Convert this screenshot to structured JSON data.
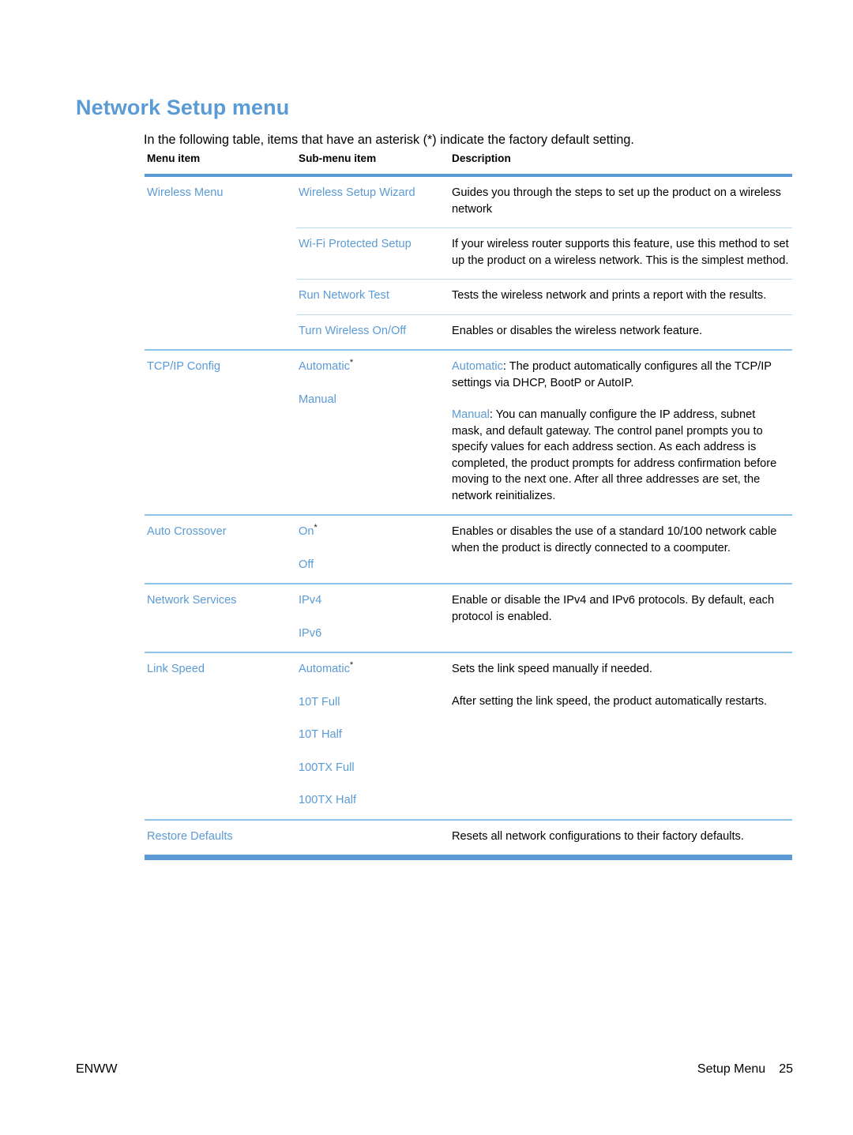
{
  "document": {
    "heading": "Network Setup menu",
    "intro": "In the following table, items that have an asterisk (*) indicate the factory default setting.",
    "accent_color": "#5b9bd5",
    "rule_color": "#8ec3ea",
    "inner_rule_color": "#b9d9ef"
  },
  "table": {
    "headers": {
      "menu_item": "Menu item",
      "sub_menu_item": "Sub-menu item",
      "description": "Description"
    },
    "rows": [
      {
        "menu_item": "Wireless Menu",
        "sub_rows": [
          {
            "sub_menu_item": "Wireless Setup Wizard",
            "default": false,
            "description": "Guides you through the steps to set up the product on a wireless network"
          },
          {
            "sub_menu_item": "Wi-Fi Protected Setup",
            "default": false,
            "description": "If your wireless router supports this feature, use this method to set up the product on a wireless network. This is the simplest method."
          },
          {
            "sub_menu_item": "Run Network Test",
            "default": false,
            "description": "Tests the wireless network and prints a report with the results."
          },
          {
            "sub_menu_item": "Turn Wireless On/Off",
            "default": false,
            "description": "Enables or disables the wireless network feature."
          }
        ]
      },
      {
        "menu_item": "TCP/IP Config",
        "sub_items": [
          {
            "label": "Automatic",
            "default": true
          },
          {
            "label": "Manual",
            "default": false
          }
        ],
        "description_parts": [
          {
            "term": "Automatic",
            "text": ": The product automatically configures all the TCP/IP settings via DHCP, BootP or AutoIP."
          },
          {
            "term": "Manual",
            "text": ": You can manually configure the IP address, subnet mask, and default gateway. The control panel prompts you to specify values for each address section. As each address is completed, the product prompts for address confirmation before moving to the next one. After all three addresses are set, the network reinitializes."
          }
        ]
      },
      {
        "menu_item": "Auto Crossover",
        "sub_items": [
          {
            "label": "On",
            "default": true
          },
          {
            "label": "Off",
            "default": false
          }
        ],
        "description_parts": [
          {
            "term": "",
            "text": "Enables or disables the use of a standard 10/100 network cable when the product is directly connected to a coomputer."
          }
        ]
      },
      {
        "menu_item": "Network Services",
        "sub_items": [
          {
            "label": "IPv4",
            "default": false
          },
          {
            "label": "IPv6",
            "default": false
          }
        ],
        "description_parts": [
          {
            "term": "",
            "text": "Enable or disable the IPv4 and IPv6 protocols. By default, each protocol is enabled."
          }
        ]
      },
      {
        "menu_item": "Link Speed",
        "sub_items": [
          {
            "label": "Automatic",
            "default": true
          },
          {
            "label": "10T Full",
            "default": false
          },
          {
            "label": "10T Half",
            "default": false
          },
          {
            "label": "100TX Full",
            "default": false
          },
          {
            "label": "100TX Half",
            "default": false
          }
        ],
        "description_parts": [
          {
            "term": "",
            "text": "Sets the link speed manually if needed."
          },
          {
            "term": "",
            "text": "After setting the link speed, the product automatically restarts."
          }
        ]
      },
      {
        "menu_item": "Restore Defaults",
        "sub_items": [],
        "description_parts": [
          {
            "term": "",
            "text": "Resets all network configurations to their factory defaults."
          }
        ]
      }
    ]
  },
  "footer": {
    "left": "ENWW",
    "section": "Setup Menu",
    "page_number": "25"
  }
}
